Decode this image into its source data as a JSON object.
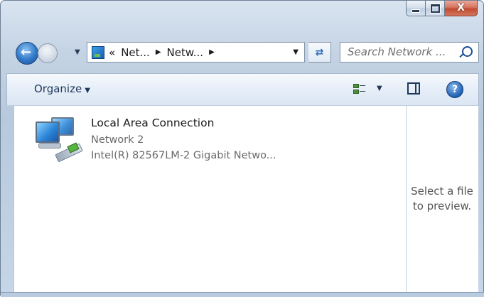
{
  "window": {
    "caption_close": "X"
  },
  "nav": {
    "breadcrumb_prefix": "«",
    "crumb_1": "Net...",
    "crumb_2": "Netw...",
    "search_placeholder": "Search Network ..."
  },
  "toolbar": {
    "organize_label": "Organize"
  },
  "content": {
    "item": {
      "title": "Local Area Connection",
      "subtitle": "Network  2",
      "description": "Intel(R) 82567LM-2 Gigabit Netwo..."
    }
  },
  "preview": {
    "line1": "Select a file",
    "line2": "to preview."
  },
  "icons": {
    "back": "back-arrow-icon",
    "forward": "forward-arrow-icon",
    "refresh": "refresh-icon",
    "search": "search-icon",
    "help": "help-icon"
  }
}
